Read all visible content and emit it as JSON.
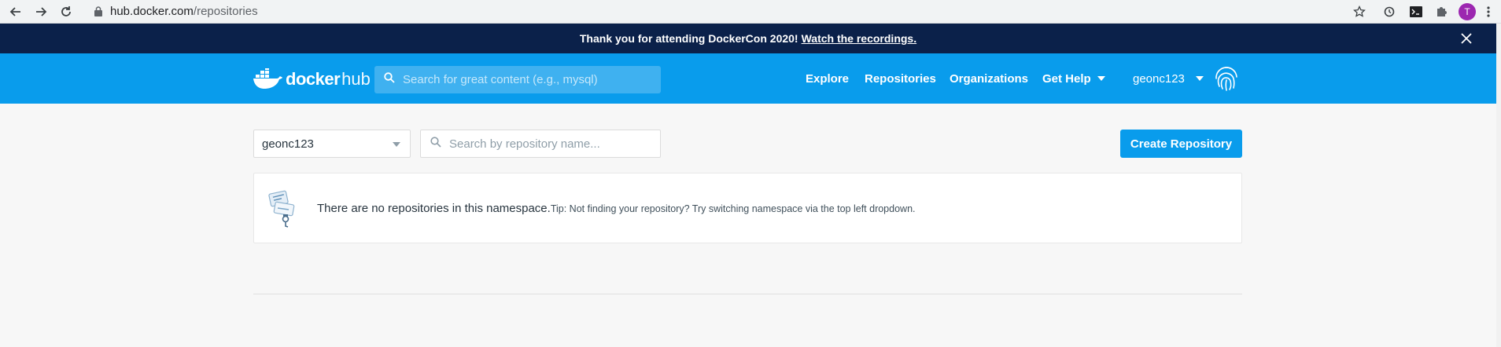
{
  "browser": {
    "url_host": "hub.docker.com",
    "url_path": "/repositories",
    "profile_initial": "T",
    "icons": [
      "back-arrow-icon",
      "forward-arrow-icon",
      "reload-icon",
      "lock-icon",
      "star-icon",
      "sync-icon",
      "terminal-icon",
      "extensions-puzzle-icon",
      "kebab-menu-icon"
    ]
  },
  "banner": {
    "message": "Thank you for attending DockerCon 2020!",
    "link": "Watch the recordings."
  },
  "header": {
    "logo_word1": "docker",
    "logo_word2": "hub",
    "search_placeholder": "Search for great content (e.g., mysql)",
    "nav": [
      "Explore",
      "Repositories",
      "Organizations",
      "Get Help"
    ],
    "username": "geonc123"
  },
  "toolbar": {
    "namespace": "geonc123",
    "repo_search_placeholder": "Search by repository name...",
    "create_label": "Create Repository"
  },
  "empty_state": {
    "message": "There are no repositories in this namespace.",
    "tip": "Tip: Not finding your repository? Try switching namespace via the top left dropdown."
  },
  "colors": {
    "header": "#099cec",
    "banner": "#0b214a",
    "button": "#099cec",
    "background": "#f7f7f7"
  }
}
